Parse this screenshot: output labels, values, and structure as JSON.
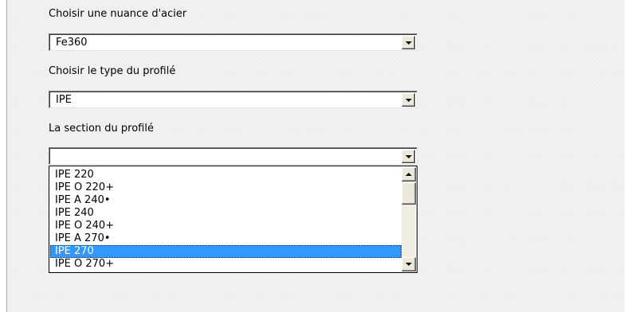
{
  "form": {
    "steel_grade": {
      "label": "Choisir une nuance d'acier",
      "value": "Fe360"
    },
    "profile_type": {
      "label": "Choisir le type du profilé",
      "value": "IPE"
    },
    "profile_section": {
      "label": "La section du profilé",
      "value": ""
    }
  },
  "dropdown": {
    "items": [
      "IPE 220",
      "IPE O 220+",
      "IPE A 240•",
      "IPE 240",
      "IPE O 240+",
      "IPE A 270•",
      "IPE 270",
      "IPE O 270+"
    ],
    "selected_index": 6,
    "selected_color": "#3399ff"
  },
  "icons": {
    "dropdown_arrow": "chevron-down-icon",
    "scroll_up": "chevron-up-icon",
    "scroll_down": "chevron-down-icon"
  }
}
